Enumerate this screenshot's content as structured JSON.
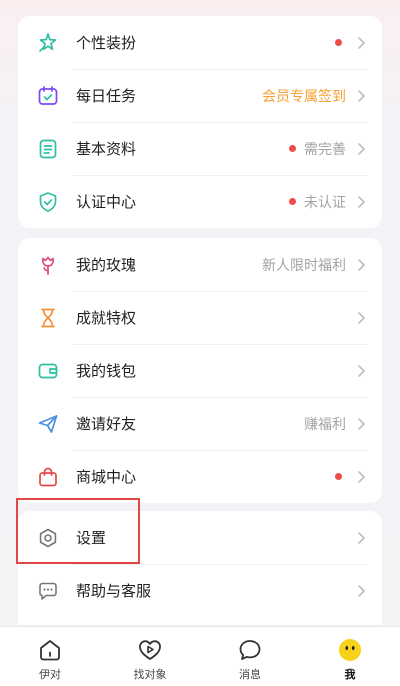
{
  "colors": {
    "accent_orange": "#f6a132",
    "red_dot": "#f04b4b",
    "icon_green": "#2fc0a1",
    "icon_purple": "#7a4cf0",
    "icon_pink": "#e04c7f",
    "icon_orange": "#f29132",
    "icon_blue": "#4a90e2",
    "icon_red": "#e8474a",
    "highlight_red": "#e14545",
    "avatar_yellow": "#f7d21a"
  },
  "group1": [
    {
      "label": "个性装扮",
      "icon": "sparkle-icon",
      "right_text": "",
      "dot": true
    },
    {
      "label": "每日任务",
      "icon": "calendar-icon",
      "right_text": "会员专属签到",
      "dot": false
    },
    {
      "label": "基本资料",
      "icon": "document-icon",
      "right_text": "需完善",
      "dot": true
    },
    {
      "label": "认证中心",
      "icon": "shield-check-icon",
      "right_text": "未认证",
      "dot": true
    }
  ],
  "group2": [
    {
      "label": "我的玫瑰",
      "icon": "rose-icon",
      "right_text": "新人限时福利",
      "dot": false
    },
    {
      "label": "成就特权",
      "icon": "hourglass-icon",
      "right_text": "",
      "dot": false
    },
    {
      "label": "我的钱包",
      "icon": "wallet-icon",
      "right_text": "",
      "dot": false
    },
    {
      "label": "邀请好友",
      "icon": "paper-plane-icon",
      "right_text": "赚福利",
      "dot": false
    },
    {
      "label": "商城中心",
      "icon": "shopping-bag-icon",
      "right_text": "",
      "dot": true
    }
  ],
  "group3": [
    {
      "label": "设置",
      "icon": "gear-icon"
    },
    {
      "label": "帮助与客服",
      "icon": "chat-bubble-icon"
    }
  ],
  "tabs": [
    {
      "label": "伊对",
      "icon": "home-icon"
    },
    {
      "label": "找对象",
      "icon": "heart-play-icon"
    },
    {
      "label": "消息",
      "icon": "message-icon"
    },
    {
      "label": "我",
      "icon": "avatar-icon",
      "active": true
    }
  ]
}
